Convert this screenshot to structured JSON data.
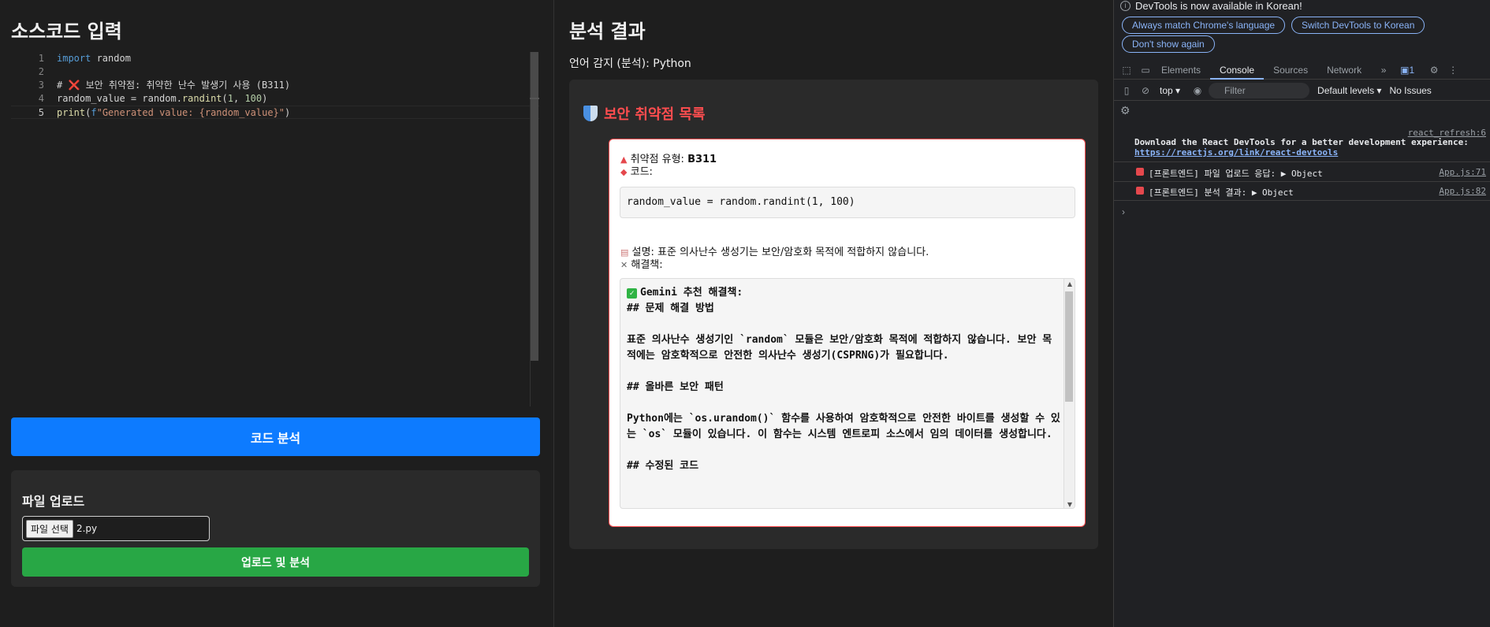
{
  "left": {
    "title": "소스코드 입력",
    "editor": {
      "lines": [
        {
          "num": "1",
          "text": "import random"
        },
        {
          "num": "2",
          "text": ""
        },
        {
          "num": "3",
          "text": "# ❌ 보안 취약점: 취약한 난수 발생기 사용 (B311)"
        },
        {
          "num": "4",
          "text": "random_value = random.randint(1, 100)"
        },
        {
          "num": "5",
          "text": "print(f\"Generated value: {random_value}\")"
        }
      ]
    },
    "analyze_button": "코드 분석",
    "upload": {
      "title": "파일 업로드",
      "file_button": "파일 선택",
      "file_name": "2.py",
      "submit_button": "업로드 및 분석"
    }
  },
  "middle": {
    "title": "분석 결과",
    "language": "언어 감지 (분석): Python",
    "vuln_list_title": "보안 취약점 목록",
    "card": {
      "type_label": "취약점 유형: ",
      "type_value": "B311",
      "code_label": "코드:",
      "code": "random_value = random.randint(1, 100)",
      "desc_label": "설명: ",
      "desc_value": "표준 의사난수 생성기는 보안/암호화 목적에 적합하지 않습니다.",
      "fix_label": "해결책:",
      "fix_text": "Gemini 추천 해결책:\n## 문제 해결 방법\n\n표준 의사난수 생성기인 `random` 모듈은 보안/암호화 목적에 적합하지 않습니다. 보안 목적에는 암호학적으로 안전한 의사난수 생성기(CSPRNG)가 필요합니다.\n\n## 올바른 보안 패턴\n\nPython에는 `os.urandom()` 함수를 사용하여 암호학적으로 안전한 바이트를 생성할 수 있는 `os` 모듈이 있습니다. 이 함수는 시스템 엔트로피 소스에서 임의 데이터를 생성합니다.\n\n## 수정된 코드"
    }
  },
  "devtools": {
    "banner": "DevTools is now available in Korean!",
    "pills": [
      "Always match Chrome's language",
      "Switch DevTools to Korean",
      "Don't show again"
    ],
    "tabs": [
      "Elements",
      "Console",
      "Sources",
      "Network"
    ],
    "issues_badge": "1",
    "context": "top",
    "filter_placeholder": "Filter",
    "levels": "Default levels",
    "issues": "No Issues",
    "logs": [
      {
        "source": "react_refresh:6",
        "text": "Download the React DevTools for a better development experience: ",
        "link": "https://reactjs.org/link/react-devtools"
      },
      {
        "source": "App.js:71",
        "text": "[프론트엔드] 파일 업로드 응답: ▶ Object"
      },
      {
        "source": "App.js:82",
        "text": "[프론트엔드] 분석 결과: ▶ Object"
      }
    ]
  }
}
